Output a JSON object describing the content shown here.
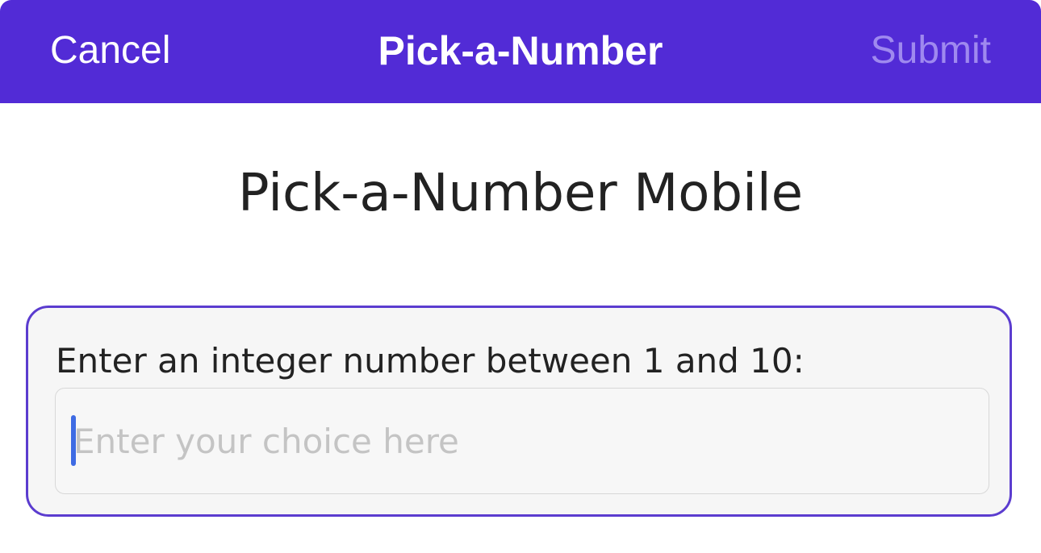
{
  "nav": {
    "cancel_label": "Cancel",
    "title": "Pick-a-Number",
    "submit_label": "Submit"
  },
  "main": {
    "heading": "Pick-a-Number Mobile",
    "form": {
      "label": "Enter an integer number between 1 and 10:",
      "input_value": "",
      "input_placeholder": "Enter your choice here"
    }
  },
  "colors": {
    "nav_background": "#522bd6",
    "submit_disabled": "#9f89ef",
    "card_border": "#5b3ccf",
    "caret": "#3e6be3"
  }
}
